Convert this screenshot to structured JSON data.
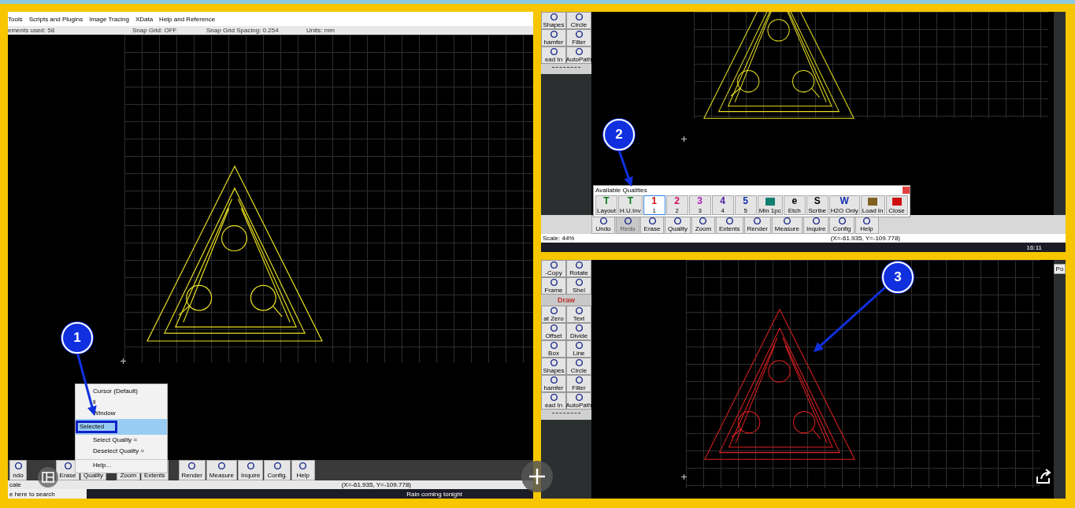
{
  "left_panel": {
    "menu_bar": [
      "Tools",
      "Scripts and Plugins",
      "Image Tracing",
      "XData",
      "Help and Reference"
    ],
    "status_fields": [
      "ements used: 58",
      "Snap Grid: OFF",
      "Snap Grid Spacing: 0.254",
      "Units: mm"
    ],
    "context_menu": [
      {
        "label": "Cursor (Default)",
        "selected": false
      },
      {
        "label": "ll",
        "selected": false
      },
      {
        "label": "Window",
        "selected": false
      },
      {
        "label": "Selected",
        "selected": true
      },
      {
        "label": "Select Quality =",
        "selected": false
      },
      {
        "label": "Deselect Quality =",
        "selected": false
      },
      {
        "label": "Help...",
        "selected": false
      }
    ],
    "toolbar": [
      {
        "label": "ndo",
        "disabled": false
      },
      {
        "label": "Erase",
        "disabled": false
      },
      {
        "label": "Quality",
        "disabled": false
      },
      {
        "label": "Zoom",
        "disabled": false
      },
      {
        "label": "Extents",
        "disabled": false
      },
      {
        "label": "Render",
        "disabled": false
      },
      {
        "label": "Measure",
        "disabled": false
      },
      {
        "label": "Inquire",
        "disabled": false
      },
      {
        "label": "Config.",
        "disabled": false
      },
      {
        "label": "Help",
        "disabled": false
      }
    ],
    "scale": "cale",
    "coordinates": "(X=-61.935, Y=-109.778)",
    "search": "e here to search",
    "weather": "Rain coming tonight",
    "callout": "1"
  },
  "top_right_panel": {
    "side_tools": [
      "Shapes",
      "Circle",
      "hamfer",
      "Filler",
      "ead In",
      "AutoPath"
    ],
    "qualities_dialog": {
      "title": "Available Qualities",
      "buttons": [
        {
          "glyph": "T",
          "label": "Layout",
          "color": "#0a7a1a",
          "selected": false
        },
        {
          "glyph": "T",
          "label": "H.U.Inv",
          "color": "#0a7a1a",
          "selected": false
        },
        {
          "glyph": "1",
          "label": "1",
          "color": "#d01010",
          "selected": true
        },
        {
          "glyph": "2",
          "label": "2",
          "color": "#d01060",
          "selected": false
        },
        {
          "glyph": "3",
          "label": "3",
          "color": "#b020c0",
          "selected": false
        },
        {
          "glyph": "4",
          "label": "4",
          "color": "#5020a0",
          "selected": false
        },
        {
          "glyph": "5",
          "label": "5",
          "color": "#1030b0",
          "selected": false
        },
        {
          "label": "Min 1pc",
          "color": "#108070",
          "selected": false
        },
        {
          "glyph": "e",
          "label": "Etch",
          "color": "#000000",
          "selected": false
        },
        {
          "glyph": "S",
          "label": "Scribe",
          "color": "#000000",
          "selected": false
        },
        {
          "glyph": "W",
          "label": "H2O Only",
          "color": "#1030b0",
          "selected": false
        },
        {
          "label": "Load In",
          "color": "#806020",
          "selected": false
        },
        {
          "label": "Close",
          "color": "#d01010",
          "selected": false
        }
      ]
    },
    "toolbar": [
      {
        "label": "Undo",
        "disabled": false
      },
      {
        "label": "Redo",
        "disabled": true
      },
      {
        "label": "Erase",
        "disabled": false
      },
      {
        "label": "Quality",
        "disabled": false
      },
      {
        "label": "Zoom",
        "disabled": false
      },
      {
        "label": "Extents",
        "disabled": false
      },
      {
        "label": "Render",
        "disabled": false
      },
      {
        "label": "Measure",
        "disabled": false
      },
      {
        "label": "Inquire",
        "disabled": false
      },
      {
        "label": "Config",
        "disabled": false
      },
      {
        "label": "Help",
        "disabled": false
      }
    ],
    "scale": "Scale: 44%",
    "coordinates": "(X=-61.935, Y=-109.778)",
    "time": "16:11",
    "callout": "2"
  },
  "bottom_right_panel": {
    "side_tools": [
      {
        "kind": "tool",
        "label": "-Copy"
      },
      {
        "kind": "tool",
        "label": "Rotate"
      },
      {
        "kind": "tool",
        "label": "Frame"
      },
      {
        "kind": "tool",
        "label": "Shel"
      },
      {
        "kind": "header",
        "label": "Draw"
      },
      {
        "kind": "tool",
        "label": "at Zero"
      },
      {
        "kind": "tool",
        "label": "Text"
      },
      {
        "kind": "tool",
        "label": "Offset"
      },
      {
        "kind": "tool",
        "label": "Divide"
      },
      {
        "kind": "tool",
        "label": "Box"
      },
      {
        "kind": "tool",
        "label": "Line"
      },
      {
        "kind": "tool",
        "label": "Shapes"
      },
      {
        "kind": "tool",
        "label": "Circle"
      },
      {
        "kind": "tool",
        "label": "hamfer"
      },
      {
        "kind": "tool",
        "label": "Filler"
      },
      {
        "kind": "tool",
        "label": "ead In"
      },
      {
        "kind": "tool",
        "label": "AutoPath"
      }
    ],
    "corner_button": "Po",
    "callout": "3"
  }
}
